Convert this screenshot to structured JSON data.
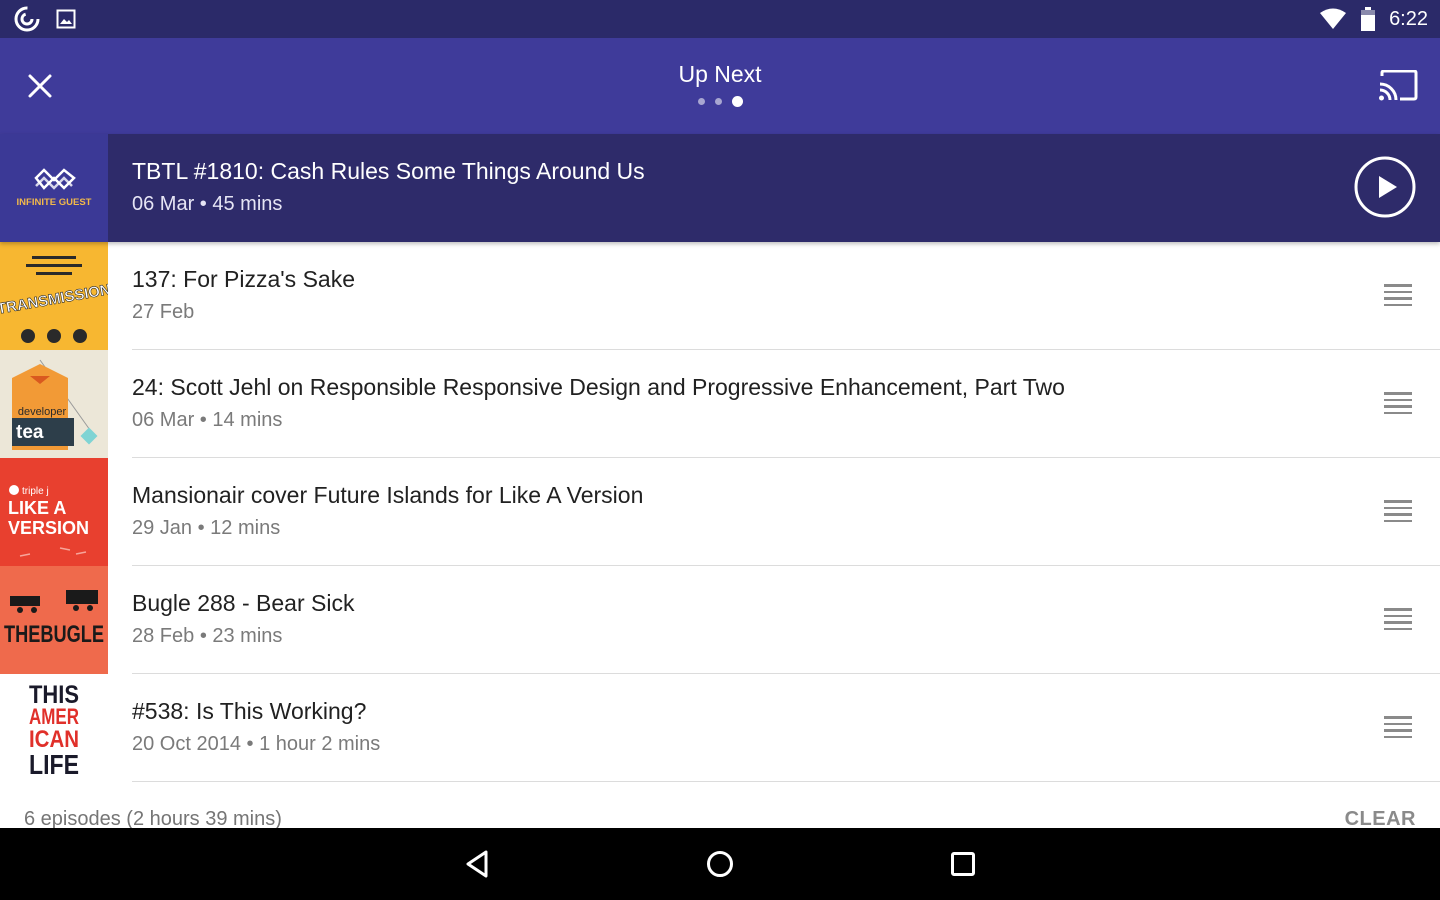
{
  "status_bar": {
    "time": "6:22"
  },
  "toolbar": {
    "title": "Up Next",
    "pages": 3,
    "active_page": 3
  },
  "now_playing": {
    "title": "TBTL #1810: Cash Rules Some Things Around Us",
    "meta": "06 Mar • 45 mins",
    "art_text": "INFINITE GUEST"
  },
  "episodes": [
    {
      "title": "137: For Pizza's Sake",
      "meta": "27 Feb",
      "art_text": "TRANSMISSION"
    },
    {
      "title": "24: Scott Jehl on Responsible Responsive Design and Progressive Enhancement, Part Two",
      "meta": "06 Mar • 14 mins",
      "art_text_1": "developer",
      "art_text_2": "tea"
    },
    {
      "title": "Mansionair cover Future Islands for Like A Version",
      "meta": "29 Jan • 12 mins",
      "art_text_1": "triple j",
      "art_text_2": "LIKE A",
      "art_text_3": "VERSION"
    },
    {
      "title": "Bugle 288 - Bear Sick",
      "meta": "28 Feb • 23 mins",
      "art_text": "THEBUGLE"
    },
    {
      "title": "#538: Is This Working?",
      "meta": "20 Oct 2014 • 1 hour 2 mins",
      "art_text_1": "THIS",
      "art_text_2": "AMER",
      "art_text_3": "ICAN",
      "art_text_4": "LIFE"
    }
  ],
  "footer": {
    "summary": "6 episodes (2 hours 39 mins)",
    "clear_label": "CLEAR"
  },
  "colors": {
    "status_bar": "#2b2a69",
    "toolbar": "#3f3b9a",
    "now_playing": "#2e2b6a"
  }
}
